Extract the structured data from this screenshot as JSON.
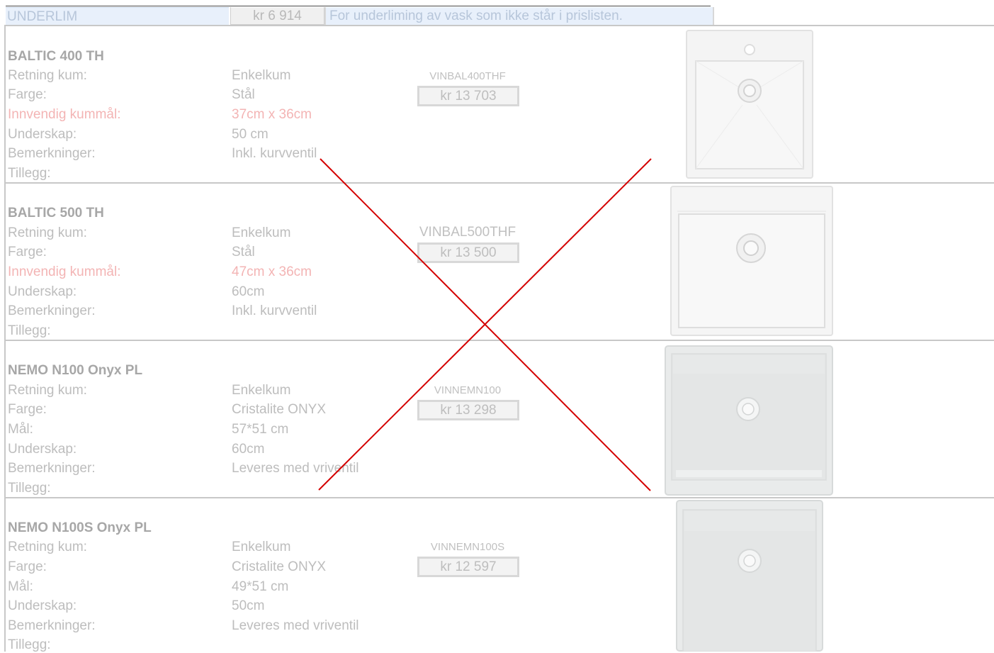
{
  "top_row": {
    "name": "UNDERLIM",
    "price": "kr 6 914",
    "note": "For underliming av vask som ikke står i prislisten."
  },
  "products": [
    {
      "title": "BALTIC 400 TH",
      "code": "VINBAL400THF",
      "price": "kr 13 703",
      "rows": [
        {
          "label": "Retning kum:",
          "value": "Enkelkum"
        },
        {
          "label": "Farge:",
          "value": "Stål"
        },
        {
          "label": "Innvendig kummål:",
          "value": "37cm x 36cm"
        },
        {
          "label": "Underskap:",
          "value": "50 cm"
        },
        {
          "label": "Bemerkninger:",
          "value": "Inkl. kurvventil"
        },
        {
          "label": "Tillegg:",
          "value": ""
        }
      ]
    },
    {
      "title": "BALTIC 500 TH",
      "code": "VINBAL500THF",
      "price": "kr 13 500",
      "rows": [
        {
          "label": "Retning kum:",
          "value": "Enkelkum"
        },
        {
          "label": "Farge:",
          "value": "Stål"
        },
        {
          "label": "Innvendig kummål:",
          "value": "47cm x 36cm"
        },
        {
          "label": "Underskap:",
          "value": "60cm"
        },
        {
          "label": "Bemerkninger:",
          "value": "Inkl. kurvventil"
        },
        {
          "label": "Tillegg:",
          "value": ""
        }
      ]
    },
    {
      "title": "NEMO N100 Onyx PL",
      "code": "VINNEMN100",
      "price": "kr 13 298",
      "rows": [
        {
          "label": "Retning kum:",
          "value": "Enkelkum"
        },
        {
          "label": "Farge:",
          "value": "Cristalite ONYX"
        },
        {
          "label": "Mål:",
          "value": "57*51 cm"
        },
        {
          "label": "Underskap:",
          "value": "60cm"
        },
        {
          "label": "Bemerkninger:",
          "value": "Leveres med vriventil"
        },
        {
          "label": "Tillegg:",
          "value": ""
        }
      ]
    },
    {
      "title": "NEMO N100S Onyx PL",
      "code": "VINNEMN100S",
      "price": "kr 12 597",
      "rows": [
        {
          "label": "Retning kum:",
          "value": "Enkelkum"
        },
        {
          "label": "Farge:",
          "value": "Cristalite ONYX"
        },
        {
          "label": "Mål:",
          "value": "49*51 cm"
        },
        {
          "label": "Underskap:",
          "value": "50cm"
        },
        {
          "label": "Bemerkninger:",
          "value": "Leveres med vriventil"
        },
        {
          "label": "Tillegg:",
          "value": ""
        }
      ]
    }
  ],
  "colors": {
    "cross": "#d40000",
    "highlight_text": "#f3b4b4",
    "header_fill": "#e8f0fb"
  }
}
